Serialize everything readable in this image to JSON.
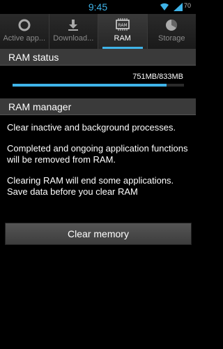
{
  "status_bar": {
    "time": "9:45",
    "battery_level": "70"
  },
  "tabs": [
    {
      "label": "Active app...",
      "icon": "ring-icon",
      "active": false
    },
    {
      "label": "Download...",
      "icon": "download-icon",
      "active": false
    },
    {
      "label": "RAM",
      "icon": "ram-chip-icon",
      "active": true,
      "icon_text": "RAM"
    },
    {
      "label": "Storage",
      "icon": "pie-chart-icon",
      "active": false
    }
  ],
  "ram_status": {
    "header": "RAM status",
    "usage_text": "751MB/833MB",
    "usage_fraction": 0.9
  },
  "ram_manager": {
    "header": "RAM manager",
    "paragraph_1": "Clear inactive and background processes.",
    "paragraph_2": "Completed and ongoing application functions will be removed from RAM.",
    "paragraph_3": "Clearing RAM will end some applications. Save data before you clear RAM"
  },
  "clear_button_label": "Clear memory",
  "colors": {
    "accent": "#3fb3e8",
    "header_bg": "#3a3a3a"
  }
}
